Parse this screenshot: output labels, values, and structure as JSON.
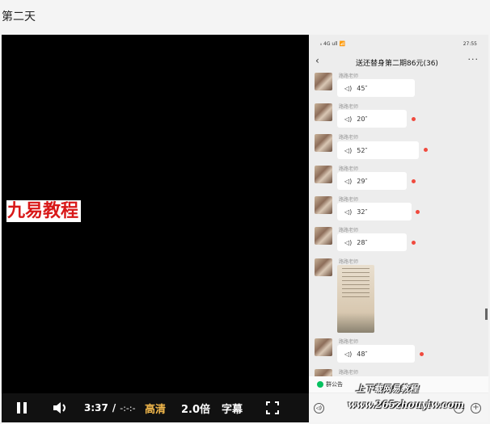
{
  "page": {
    "title": "第二天"
  },
  "video": {
    "watermark": "九易教程"
  },
  "phone": {
    "status_left": "ᵢᵢ 4G ull 📶",
    "status_right": "27:55",
    "chat_title": "送还替身第二期86元(36)",
    "back": "‹",
    "more": "···",
    "sender": "路路老师",
    "messages": [
      {
        "duration": "45″",
        "unread": false
      },
      {
        "duration": "20″",
        "unread": true
      },
      {
        "duration": "52″",
        "unread": true
      },
      {
        "duration": "29″",
        "unread": true
      },
      {
        "duration": "32″",
        "unread": true
      },
      {
        "duration": "28″",
        "unread": true
      },
      {
        "duration": "48″",
        "unread": true
      }
    ],
    "notice": "群公告",
    "site_watermark_1": "上下载网易教程",
    "site_watermark_2": "www.265zhouyiw.com"
  },
  "controls": {
    "time_current": "3:37",
    "time_sep": "/",
    "time_total": "-:-:-",
    "quality": "高清",
    "speed": "2.0倍",
    "subtitle": "字幕"
  },
  "colors": {
    "accent": "#f2b84b",
    "unread_dot": "#f04a3e",
    "watermark_red": "#d81818"
  }
}
